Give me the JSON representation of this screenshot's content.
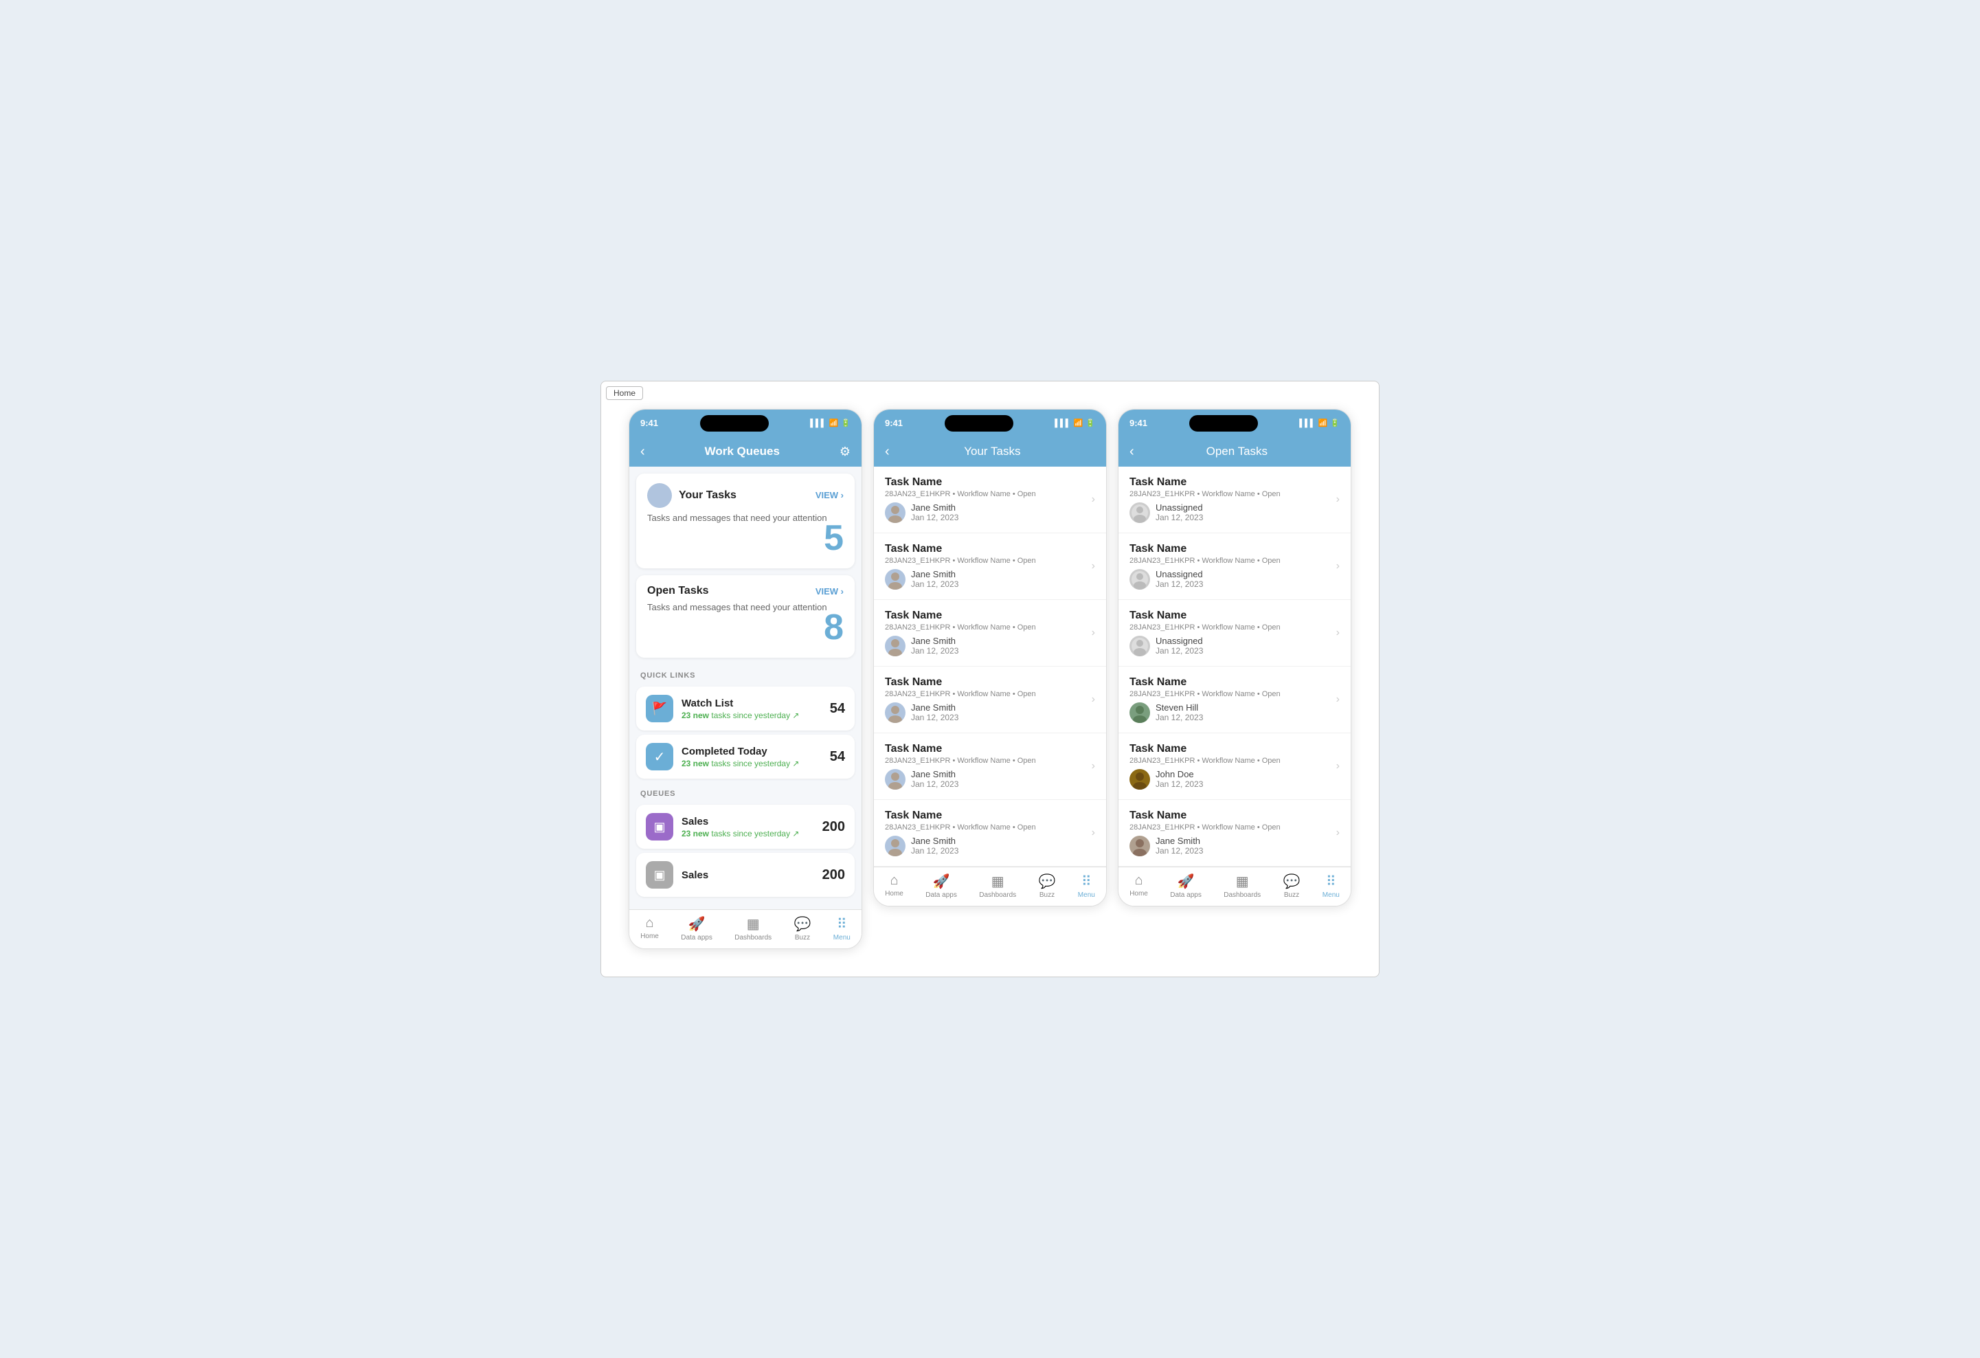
{
  "home_tab": "Home",
  "phones": [
    {
      "id": "work-queues-phone",
      "time": "9:41",
      "title": "Work Queues",
      "title_style": "bold",
      "has_back": true,
      "has_gear": true,
      "cards": [
        {
          "id": "your-tasks-card",
          "has_avatar": true,
          "title": "Your Tasks",
          "view_label": "VIEW",
          "subtitle": "Tasks and messages that need your attention",
          "count": "5"
        },
        {
          "id": "open-tasks-card",
          "has_avatar": false,
          "title": "Open Tasks",
          "view_label": "VIEW",
          "subtitle": "Tasks and messages that need your attention",
          "count": "8"
        }
      ],
      "quick_links_label": "QUICK LINKS",
      "quick_links": [
        {
          "id": "watch-list-link",
          "icon": "🚩",
          "icon_style": "blue",
          "name": "Watch List",
          "new_count": "23",
          "new_label": "new tasks since yesterday",
          "count": "54"
        },
        {
          "id": "completed-today-link",
          "icon": "✓",
          "icon_style": "blue",
          "name": "Completed Today",
          "new_count": "23",
          "new_label": "tasks since yesterday",
          "count": "54"
        }
      ],
      "queues_label": "QUEUES",
      "queues": [
        {
          "id": "sales-queue-1",
          "icon": "▣",
          "icon_style": "purple",
          "name": "Sales",
          "new_count": "23",
          "new_label": "new tasks since yesterday",
          "count": "200"
        },
        {
          "id": "sales-queue-2",
          "icon": "▣",
          "icon_style": "gray",
          "name": "Sales",
          "new_count": "",
          "new_label": "",
          "count": "200"
        }
      ],
      "bottom_nav": [
        {
          "id": "home-nav",
          "icon": "⌂",
          "label": "Home",
          "active": false
        },
        {
          "id": "data-apps-nav",
          "icon": "🚀",
          "label": "Data apps",
          "active": false
        },
        {
          "id": "dashboards-nav",
          "icon": "▦",
          "label": "Dashboards",
          "active": false
        },
        {
          "id": "buzz-nav",
          "icon": "💬",
          "label": "Buzz",
          "active": false
        },
        {
          "id": "menu-nav",
          "icon": "⠿",
          "label": "Menu",
          "active": true
        }
      ]
    },
    {
      "id": "your-tasks-phone",
      "time": "9:41",
      "title": "Your Tasks",
      "title_style": "light",
      "has_back": true,
      "has_gear": false,
      "tasks": [
        {
          "id": "task-1",
          "name": "Task Name",
          "meta": "28JAN23_E1HKPR • Workflow Name • Open",
          "assignee": "Jane Smith",
          "date": "Jan 12, 2023",
          "avatar_type": "person"
        },
        {
          "id": "task-2",
          "name": "Task Name",
          "meta": "28JAN23_E1HKPR • Workflow Name • Open",
          "assignee": "Jane Smith",
          "date": "Jan 12, 2023",
          "avatar_type": "person"
        },
        {
          "id": "task-3",
          "name": "Task Name",
          "meta": "28JAN23_E1HKPR • Workflow Name • Open",
          "assignee": "Jane Smith",
          "date": "Jan 12, 2023",
          "avatar_type": "person"
        },
        {
          "id": "task-4",
          "name": "Task Name",
          "meta": "28JAN23_E1HKPR • Workflow Name • Open",
          "assignee": "Jane Smith",
          "date": "Jan 12, 2023",
          "avatar_type": "person"
        },
        {
          "id": "task-5",
          "name": "Task Name",
          "meta": "28JAN23_E1HKPR • Workflow Name • Open",
          "assignee": "Jane Smith",
          "date": "Jan 12, 2023",
          "avatar_type": "person"
        },
        {
          "id": "task-6",
          "name": "Task Name",
          "meta": "28JAN23_E1HKPR • Workflow Name • Open",
          "assignee": "Jane Smith",
          "date": "Jan 12, 2023",
          "avatar_type": "person"
        }
      ],
      "bottom_nav": [
        {
          "id": "home-nav",
          "icon": "⌂",
          "label": "Home",
          "active": false
        },
        {
          "id": "data-apps-nav",
          "icon": "🚀",
          "label": "Data apps",
          "active": false
        },
        {
          "id": "dashboards-nav",
          "icon": "▦",
          "label": "Dashboards",
          "active": false
        },
        {
          "id": "buzz-nav",
          "icon": "💬",
          "label": "Buzz",
          "active": false
        },
        {
          "id": "menu-nav",
          "icon": "⠿",
          "label": "Menu",
          "active": true
        }
      ]
    },
    {
      "id": "open-tasks-phone",
      "time": "9:41",
      "title": "Open Tasks",
      "title_style": "light",
      "has_back": true,
      "has_gear": false,
      "tasks": [
        {
          "id": "otask-1",
          "name": "Task Name",
          "meta": "28JAN23_E1HKPR • Workflow Name • Open",
          "assignee": "Unassigned",
          "date": "Jan 12, 2023",
          "avatar_type": "unassigned"
        },
        {
          "id": "otask-2",
          "name": "Task Name",
          "meta": "28JAN23_E1HKPR • Workflow Name • Open",
          "assignee": "Unassigned",
          "date": "Jan 12, 2023",
          "avatar_type": "unassigned"
        },
        {
          "id": "otask-3",
          "name": "Task Name",
          "meta": "28JAN23_E1HKPR • Workflow Name • Open",
          "assignee": "Unassigned",
          "date": "Jan 12, 2023",
          "avatar_type": "unassigned"
        },
        {
          "id": "otask-4",
          "name": "Task Name",
          "meta": "28JAN23_E1HKPR • Workflow Name • Open",
          "assignee": "Steven Hill",
          "date": "Jan 12, 2023",
          "avatar_type": "person2"
        },
        {
          "id": "otask-5",
          "name": "Task Name",
          "meta": "28JAN23_E1HKPR • Workflow Name • Open",
          "assignee": "John Doe",
          "date": "Jan 12, 2023",
          "avatar_type": "person3"
        },
        {
          "id": "otask-6",
          "name": "Task Name",
          "meta": "28JAN23_E1HKPR • Workflow Name • Open",
          "assignee": "Jane Smith",
          "date": "Jan 12, 2023",
          "avatar_type": "person"
        }
      ],
      "bottom_nav": [
        {
          "id": "home-nav",
          "icon": "⌂",
          "label": "Home",
          "active": false
        },
        {
          "id": "data-apps-nav",
          "icon": "🚀",
          "label": "Data apps",
          "active": false
        },
        {
          "id": "dashboards-nav",
          "icon": "▦",
          "label": "Dashboards",
          "active": false
        },
        {
          "id": "buzz-nav",
          "icon": "💬",
          "label": "Buzz",
          "active": false
        },
        {
          "id": "menu-nav",
          "icon": "⠿",
          "label": "Menu",
          "active": true
        }
      ]
    }
  ]
}
